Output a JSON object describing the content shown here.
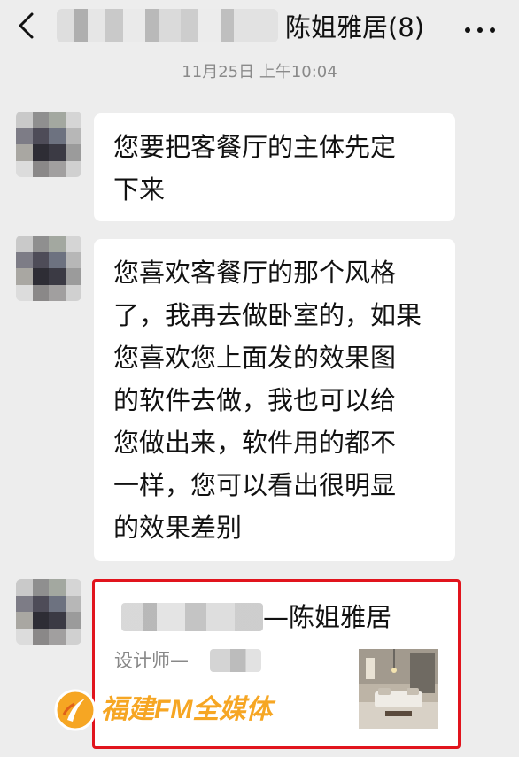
{
  "header": {
    "title": "陈姐雅居(8)",
    "back_icon": "chevron-left-icon",
    "more_icon": "ellipsis-icon"
  },
  "chat": {
    "timestamp": "11月25日 上午10:04",
    "messages": [
      {
        "lines": [
          "您要把客餐厅的主体先定",
          "下来"
        ]
      },
      {
        "lines": [
          "您喜欢客餐厅的那个风格",
          "了，我再去做卧室的，如果",
          "您喜欢您上面发的效果图",
          "的软件去做，我也可以给",
          "您做出来，软件用的都不",
          "一样，您可以看出很明显",
          "的效果差别"
        ]
      }
    ],
    "card": {
      "title": "—陈姐雅居",
      "subtitle": "设计师—",
      "highlight_color": "#e1141d"
    }
  },
  "watermark": {
    "text": "福建FM全媒体",
    "color": "#f6a623"
  }
}
